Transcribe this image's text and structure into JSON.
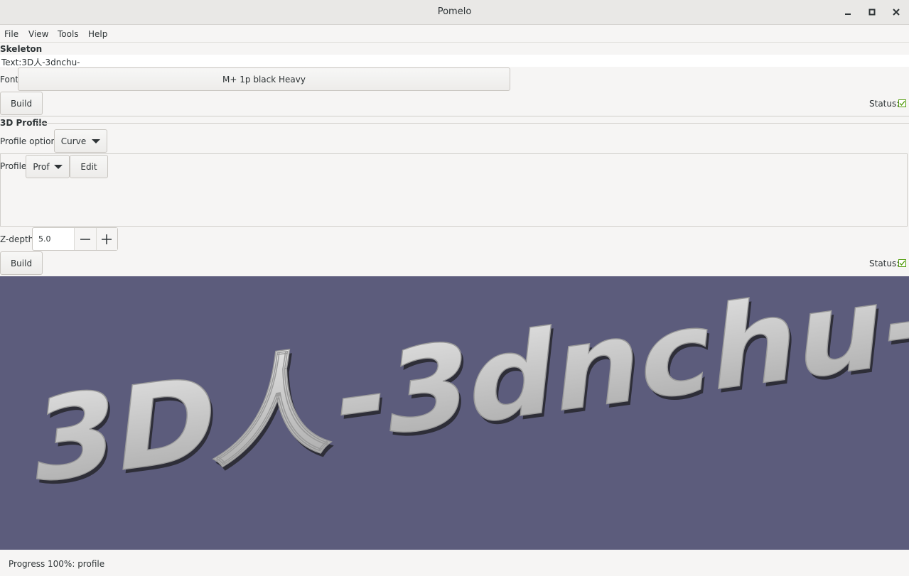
{
  "window": {
    "title": "Pomelo"
  },
  "menu": [
    "File",
    "View",
    "Tools",
    "Help"
  ],
  "skeleton": {
    "section_label": "Skeleton",
    "text_value": "Text:3D人-3dnchu-",
    "font_label": "Font:",
    "font_value": "M+ 1p black Heavy",
    "build_label": "Build",
    "status_label": "Status:"
  },
  "profile3d": {
    "section_label": "3D Profile",
    "profile_option_label": "Profile option:",
    "profile_option_value": "Curve",
    "profile_label": "Profile:",
    "profile_value": "Prof",
    "edit_label": "Edit",
    "zdepth_label": "Z-depth:",
    "zdepth_value": "5.0",
    "build_label": "Build",
    "status_label": "Status:"
  },
  "viewport": {
    "rendered_text": "3D人-3dnchu-",
    "background_color": "#5c5c7c",
    "text_color": "#c8c8c8"
  },
  "statusbar": {
    "text": "Progress 100%: profile"
  }
}
